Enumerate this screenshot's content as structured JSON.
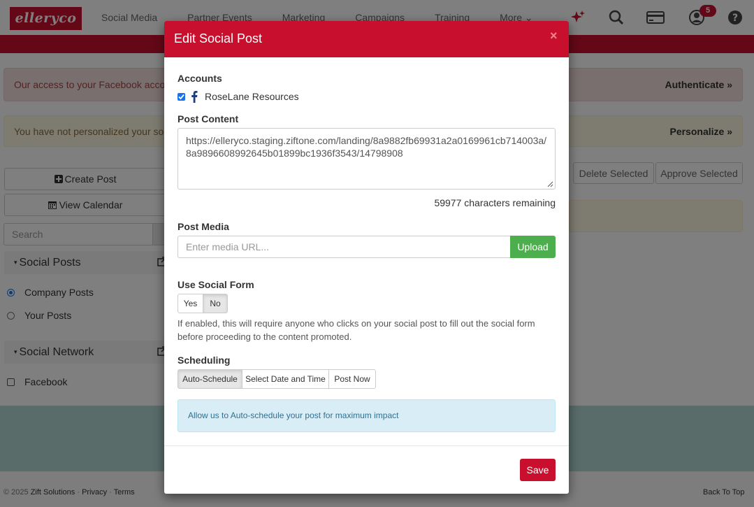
{
  "app": {
    "logo": "elleryco"
  },
  "nav": {
    "items": [
      "Social Media",
      "Partner Events",
      "Marketing",
      "Campaigns",
      "Training",
      "More"
    ],
    "notifications_count": "5",
    "icons": [
      "sparkle-icon",
      "search-icon",
      "credit-card-icon",
      "user-icon",
      "help-icon"
    ]
  },
  "alerts": {
    "facebook": {
      "text": "Our access to your Facebook account",
      "action": "Authenticate"
    },
    "personalize": {
      "text": "You have not personalized your social",
      "action": "Personalize"
    }
  },
  "sidebar": {
    "create_post": "Create Post",
    "view_calendar": "View Calendar",
    "search_placeholder": "Search",
    "social_posts_heading": "Social Posts",
    "post_options": [
      {
        "label": "Company Posts",
        "selected": true
      },
      {
        "label": "Your Posts",
        "selected": false
      }
    ],
    "social_network_heading": "Social Network",
    "network_options": [
      {
        "label": "Facebook",
        "checked": false
      }
    ]
  },
  "toolbar": {
    "delete_selected": "Delete Selected",
    "approve_selected": "Approve Selected"
  },
  "footer": {
    "copyright": "© 2025",
    "company": "Zift Solutions",
    "privacy": "Privacy",
    "terms": "Terms",
    "back_to_top": "Back To Top"
  },
  "modal": {
    "title": "Edit Social Post",
    "close": "×",
    "accounts_label": "Accounts",
    "account_name": "RoseLane Resources",
    "account_checked": true,
    "post_content_label": "Post Content",
    "post_content": "https://elleryco.staging.ziftone.com/landing/8a9882fb69931a2a0169961cb714003a/8a9896608992645b01899bc1936f3543/14798908",
    "chars_remaining": "59977 characters remaining",
    "post_media_label": "Post Media",
    "media_placeholder": "Enter media URL...",
    "upload": "Upload",
    "social_form_label": "Use Social Form",
    "social_form_options": [
      "Yes",
      "No"
    ],
    "social_form_selected": "No",
    "social_form_help": "If enabled, this will require anyone who clicks on your social post to fill out the social form before proceeding to the content promoted.",
    "scheduling_label": "Scheduling",
    "scheduling_options": [
      "Auto-Schedule",
      "Select Date and Time",
      "Post Now"
    ],
    "scheduling_selected": "Auto-Schedule",
    "scheduling_info": "Allow us to Auto-schedule your post for maximum impact",
    "save": "Save"
  },
  "colors": {
    "brand": "#c8102e",
    "success": "#4cae4c",
    "info_bg": "#d9edf7",
    "teal_band": "#b3d9d4"
  }
}
